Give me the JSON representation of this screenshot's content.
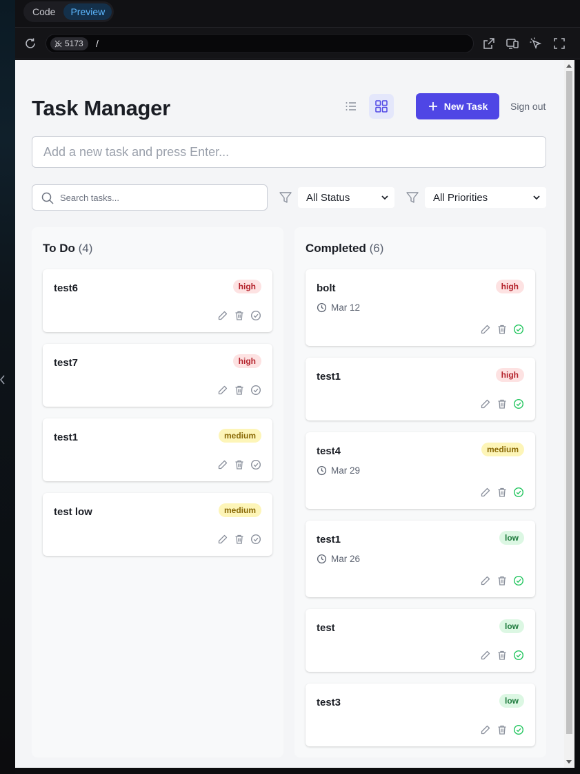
{
  "editor": {
    "tabs": [
      {
        "label": "Code",
        "active": false
      },
      {
        "label": "Preview",
        "active": true
      }
    ],
    "port": "5173",
    "path": "/"
  },
  "app": {
    "title": "Task Manager",
    "new_task_label": "New Task",
    "sign_out_label": "Sign out",
    "add_placeholder": "Add a new task and press Enter...",
    "search_placeholder": "Search tasks...",
    "status_filter": "All Status",
    "priority_filter": "All Priorities",
    "accent_color": "#4f46e5"
  },
  "columns": [
    {
      "title": "To Do",
      "count": "(4)",
      "tasks": [
        {
          "name": "test6",
          "priority": "high",
          "due": ""
        },
        {
          "name": "test7",
          "priority": "high",
          "due": ""
        },
        {
          "name": "test1",
          "priority": "medium",
          "due": ""
        },
        {
          "name": "test low",
          "priority": "medium",
          "due": ""
        }
      ]
    },
    {
      "title": "Completed",
      "count": "(6)",
      "tasks": [
        {
          "name": "bolt",
          "priority": "high",
          "due": "Mar 12"
        },
        {
          "name": "test1",
          "priority": "high",
          "due": ""
        },
        {
          "name": "test4",
          "priority": "medium",
          "due": "Mar 29"
        },
        {
          "name": "test1",
          "priority": "low",
          "due": "Mar 26"
        },
        {
          "name": "test",
          "priority": "low",
          "due": ""
        },
        {
          "name": "test3",
          "priority": "low",
          "due": ""
        }
      ]
    }
  ]
}
